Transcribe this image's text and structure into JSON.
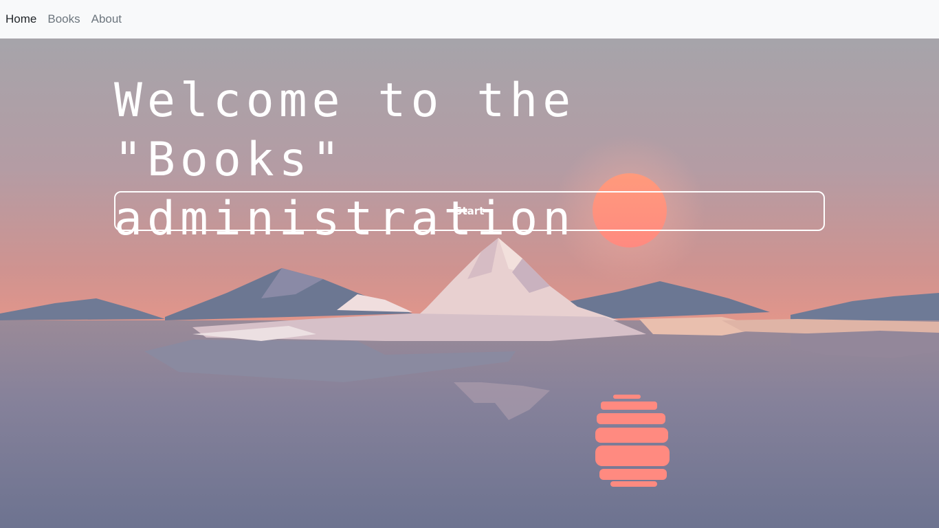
{
  "nav": {
    "items": [
      {
        "label": "Home",
        "active": true
      },
      {
        "label": "Books",
        "active": false
      },
      {
        "label": "About",
        "active": false
      }
    ]
  },
  "hero": {
    "title": "Welcome to the \"Books\" administration",
    "start_label": "Start",
    "background": "low-poly-mountain-lake-sunset",
    "colors": {
      "sky_top": "#a6a4aa",
      "sky_horizon": "#d99590",
      "water": "#6f7590",
      "sun": "#ff8a78"
    }
  }
}
